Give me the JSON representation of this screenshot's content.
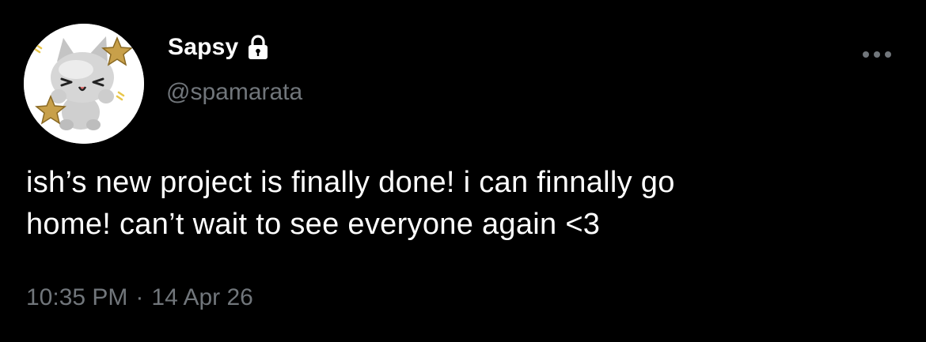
{
  "tweet": {
    "author": {
      "display_name": "Sapsy",
      "handle": "@spamarata",
      "protected_icon": "lock-icon",
      "avatar_icon": "cat-with-stars-avatar"
    },
    "text_lines": [
      "ish’s new project is finally done! i can finnally go",
      "home! can’t wait to see everyone again <3"
    ],
    "time": "10:35 PM",
    "separator": "·",
    "date": "14 Apr 26",
    "more_icon": "more-horizontal-icon"
  },
  "colors": {
    "background": "#000000",
    "primary_text": "#ffffff",
    "secondary_text": "#71767b"
  }
}
